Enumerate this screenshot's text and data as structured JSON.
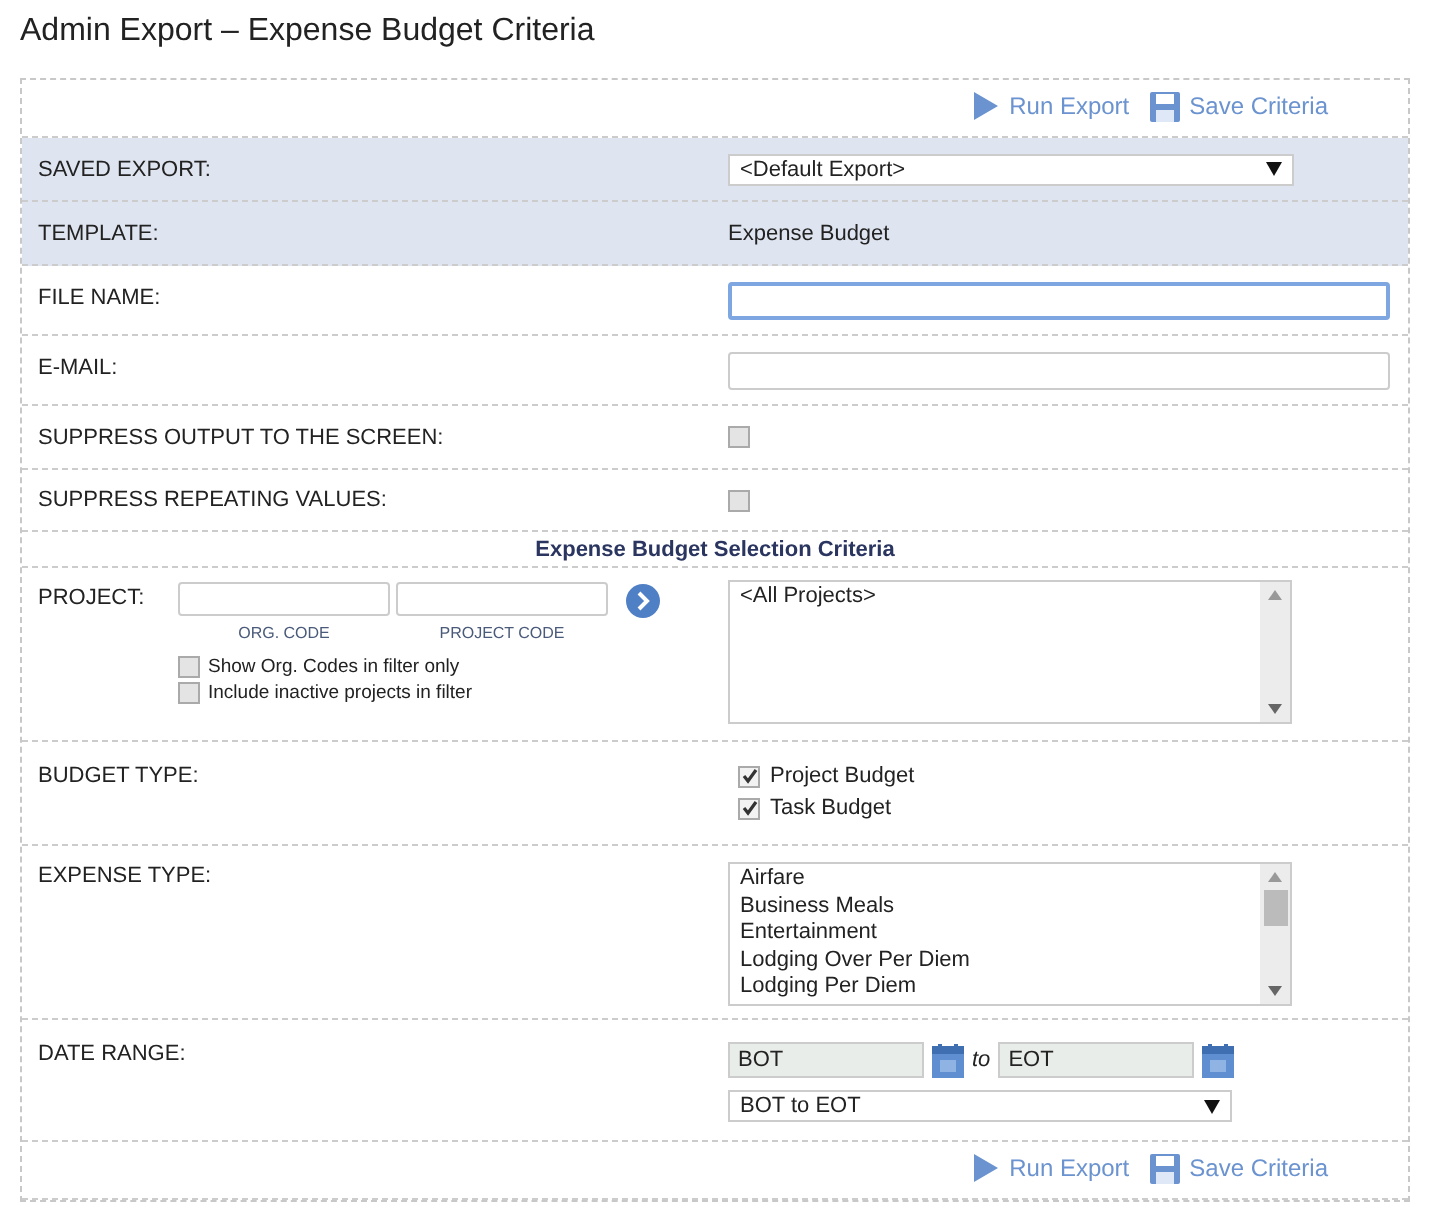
{
  "page_title": "Admin Export – Expense Budget Criteria",
  "toolbar_top": [
    {
      "kind": "run",
      "label": "Run Export"
    },
    {
      "kind": "save",
      "label": "Save Criteria"
    }
  ],
  "saved_export": {
    "label": "SAVED EXPORT:",
    "value": "<Default Export>"
  },
  "template": {
    "label": "TEMPLATE:",
    "value": "Expense Budget"
  },
  "file_name": {
    "label": "FILE NAME:",
    "focused": true
  },
  "email": {
    "label": "E-MAIL:",
    "focused": false
  },
  "suppress_output": {
    "label": "SUPPRESS OUTPUT TO THE SCREEN:",
    "checked": false
  },
  "suppress_repeating": {
    "label": "SUPPRESS REPEATING VALUES:",
    "checked": false
  },
  "section_heading": "Expense Budget Selection Criteria",
  "project": {
    "label": "PROJECT:",
    "org_code_caption": "ORG. CODE",
    "project_code_caption": "PROJECT CODE",
    "options": [
      {
        "label": "Show Org. Codes in filter only",
        "checked": false
      },
      {
        "label": "Include inactive projects in filter",
        "checked": false
      }
    ],
    "list": [
      {
        "label": "<All Projects>",
        "selected": false
      }
    ]
  },
  "budget_type": {
    "label": "BUDGET TYPE:",
    "options": [
      {
        "label": "Project Budget",
        "checked": true
      },
      {
        "label": "Task Budget",
        "checked": true
      }
    ]
  },
  "expense_type": {
    "label": "EXPENSE TYPE:",
    "list": [
      {
        "label": "Airfare",
        "selected": false
      },
      {
        "label": "Business Meals",
        "selected": false
      },
      {
        "label": "Entertainment",
        "selected": false
      },
      {
        "label": "Lodging Over Per Diem",
        "selected": false
      },
      {
        "label": "Lodging Per Diem",
        "selected": false
      }
    ]
  },
  "date_range": {
    "label": "DATE RANGE:",
    "from": "BOT",
    "to_word": "to",
    "to": "EOT",
    "preset": "BOT to EOT"
  },
  "toolbar_bottom": [
    {
      "kind": "run",
      "label": "Run Export"
    },
    {
      "kind": "save",
      "label": "Save Criteria"
    }
  ]
}
